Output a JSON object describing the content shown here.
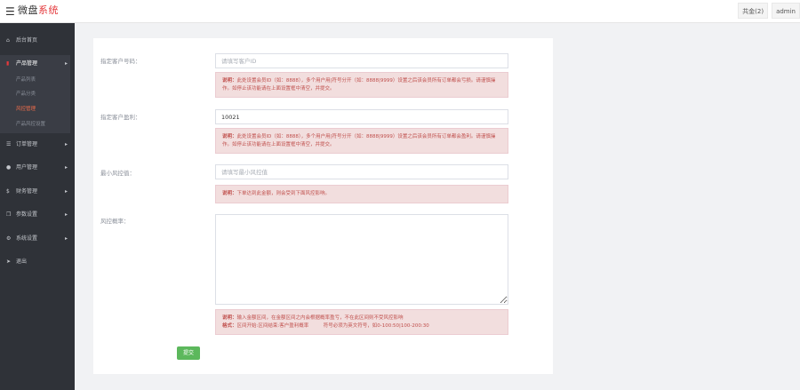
{
  "header": {
    "brand_main": "微盘",
    "brand_accent": "系统",
    "balance_label": "共金(2)",
    "user": "admin"
  },
  "sidebar": {
    "items": [
      {
        "label": "后台首页",
        "icon": "home-icon"
      },
      {
        "label": "产品管理",
        "icon": "bookmark-icon",
        "expanded": true
      },
      {
        "label": "订单管理",
        "icon": "list-icon"
      },
      {
        "label": "用户管理",
        "icon": "user-icon"
      },
      {
        "label": "财务管理",
        "icon": "money-icon"
      },
      {
        "label": "参数设置",
        "icon": "copy-icon"
      },
      {
        "label": "系统设置",
        "icon": "gears-icon"
      },
      {
        "label": "退出",
        "icon": "signout-icon"
      }
    ],
    "sub_items": [
      {
        "label": "产品列表"
      },
      {
        "label": "产品分类"
      },
      {
        "label": "风控管理",
        "current": true
      },
      {
        "label": "产品风控设置"
      }
    ]
  },
  "form": {
    "field1": {
      "label": "指定客户号码：",
      "placeholder": "请填写客户ID",
      "note_prefix": "说明：",
      "note_text": "此处设置会员ID（如：8888），多个用户用|符号分开（如：8888|9999）设置之后该会员所有订单都会亏损。请谨慎操作。如停止该功能请在上面设置框中清空，并提交。"
    },
    "field2": {
      "label": "指定客户盈利：",
      "value": "10021",
      "note_prefix": "说明：",
      "note_text": "此处设置会员ID（如：8888），多个用户用|符号分开（如：8888|9999）设置之后该会员所有订单都会盈利。请谨慎操作。如停止该功能请在上面设置框中清空，并提交。"
    },
    "field3": {
      "label": "最小风控值：",
      "placeholder": "请填写最小风控值",
      "note_prefix": "说明：",
      "note_text": "下单达到此金额，则会受到下面风控影响。"
    },
    "field4": {
      "label": "风控概率：",
      "note_prefix": "说明：",
      "note_line1": "输入金额区间，在金额区间之内会根据概率盈亏，不在此区间则不受风控影响",
      "note_prefix2": "格式：",
      "note_line2": "区间开始:区间结束:客户盈利概率　　　符号必须为英文符号，如0-100:50|100-200:30"
    },
    "submit_label": "提交"
  }
}
